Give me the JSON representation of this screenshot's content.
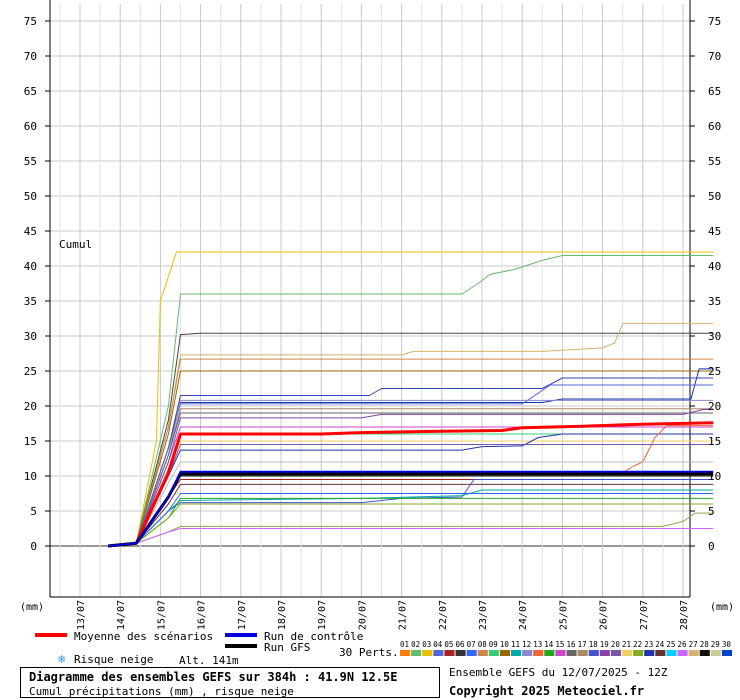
{
  "chart_data": {
    "type": "line",
    "title": "Diagramme des ensembles GEFS sur 384h : 41.9N 12.5E",
    "subtitle": "Cumul précipitations (mm) , risque neige",
    "ylabel": "(mm)",
    "ylabel_right": "(mm)",
    "chart_label": "Cumul",
    "ylim": [
      -10,
      78
    ],
    "yticks": [
      0,
      5,
      10,
      15,
      20,
      25,
      30,
      35,
      40,
      45,
      50,
      55,
      60,
      65,
      70,
      75
    ],
    "x_dates": [
      "13/07",
      "14/07",
      "15/07",
      "16/07",
      "17/07",
      "18/07",
      "19/07",
      "20/07",
      "21/07",
      "22/07",
      "23/07",
      "24/07",
      "25/07",
      "26/07",
      "27/07",
      "28/07"
    ],
    "grid": true,
    "legend": {
      "mean": "Moyenne des scénarios",
      "control": "Run de contrôle",
      "gfs": "Run GFS",
      "perts": "30 Perts.",
      "snow": "Risque neige",
      "altitude": "Alt. 141m"
    },
    "perturbation_labels": [
      "01",
      "02",
      "03",
      "04",
      "05",
      "06",
      "07",
      "08",
      "09",
      "10",
      "11",
      "12",
      "13",
      "14",
      "15",
      "16",
      "17",
      "18",
      "19",
      "20",
      "21",
      "22",
      "23",
      "24",
      "25",
      "26",
      "27",
      "28",
      "29",
      "30"
    ],
    "series": [
      {
        "name": "Moyenne des scénarios",
        "color": "#ff0000",
        "width": 3,
        "points": [
          [
            0.7,
            0
          ],
          [
            1.4,
            0.4
          ],
          [
            2.2,
            10.5
          ],
          [
            2.5,
            16
          ],
          [
            6.0,
            16
          ],
          [
            7.0,
            16.2
          ],
          [
            8.0,
            16.3
          ],
          [
            9.0,
            16.4
          ],
          [
            10.5,
            16.5
          ],
          [
            11.0,
            16.9
          ],
          [
            12.5,
            17.1
          ],
          [
            14.0,
            17.4
          ],
          [
            15.75,
            17.6
          ]
        ]
      },
      {
        "name": "Run de contrôle",
        "color": "#0000dd",
        "width": 2,
        "points": [
          [
            0.7,
            0
          ],
          [
            1.4,
            0.4
          ],
          [
            2.2,
            7
          ],
          [
            2.5,
            10.6
          ],
          [
            15.75,
            10.6
          ]
        ]
      },
      {
        "name": "Run GFS",
        "color": "#000000",
        "width": 3,
        "points": [
          [
            0.7,
            0
          ],
          [
            1.4,
            0.4
          ],
          [
            2.2,
            7
          ],
          [
            2.5,
            10.3
          ],
          [
            15.75,
            10.3
          ]
        ]
      },
      {
        "name": "01",
        "color": "#e8c000",
        "width": 1,
        "points": [
          [
            0.7,
            0
          ],
          [
            1.4,
            0.4
          ],
          [
            1.9,
            15
          ],
          [
            2.0,
            35
          ],
          [
            2.4,
            42
          ],
          [
            15.75,
            42
          ]
        ]
      },
      {
        "name": "02",
        "color": "#66bb66",
        "width": 1,
        "points": [
          [
            0.7,
            0
          ],
          [
            1.4,
            0.4
          ],
          [
            2.2,
            20
          ],
          [
            2.5,
            36
          ],
          [
            9.5,
            36
          ],
          [
            9.9,
            37.5
          ],
          [
            10.2,
            38.8
          ],
          [
            10.8,
            39.5
          ],
          [
            11.5,
            40.8
          ],
          [
            12.0,
            41.5
          ],
          [
            15.75,
            41.5
          ]
        ]
      },
      {
        "name": "03",
        "color": "#444444",
        "width": 1,
        "points": [
          [
            0.7,
            0
          ],
          [
            1.4,
            0.4
          ],
          [
            2.2,
            18
          ],
          [
            2.5,
            30.2
          ],
          [
            3.0,
            30.4
          ],
          [
            15.75,
            30.4
          ]
        ]
      },
      {
        "name": "04",
        "color": "#d8b070",
        "width": 1,
        "points": [
          [
            0.7,
            0
          ],
          [
            1.4,
            0.4
          ],
          [
            2.2,
            17
          ],
          [
            2.5,
            27.3
          ],
          [
            8.0,
            27.3
          ],
          [
            8.3,
            27.8
          ],
          [
            11.5,
            27.8
          ],
          [
            13.0,
            28.3
          ],
          [
            13.3,
            29
          ],
          [
            13.5,
            31.8
          ],
          [
            15.75,
            31.8
          ]
        ]
      },
      {
        "name": "05",
        "color": "#cc8844",
        "width": 1,
        "points": [
          [
            0.7,
            0
          ],
          [
            1.4,
            0.4
          ],
          [
            2.2,
            17
          ],
          [
            2.5,
            26.7
          ],
          [
            15.75,
            26.7
          ]
        ]
      },
      {
        "name": "06",
        "color": "#996600",
        "width": 1,
        "points": [
          [
            0.7,
            0
          ],
          [
            1.4,
            0.4
          ],
          [
            2.2,
            16
          ],
          [
            2.5,
            25
          ],
          [
            15.75,
            25
          ]
        ]
      },
      {
        "name": "07",
        "color": "#1133aa",
        "width": 1,
        "points": [
          [
            0.7,
            0
          ],
          [
            1.4,
            0.4
          ],
          [
            2.2,
            14
          ],
          [
            2.5,
            20.5
          ],
          [
            11.5,
            20.5
          ],
          [
            12.0,
            21
          ],
          [
            15.2,
            21
          ],
          [
            15.4,
            25.3
          ],
          [
            15.75,
            25.3
          ]
        ]
      },
      {
        "name": "08",
        "color": "#3344bb",
        "width": 1,
        "points": [
          [
            0.7,
            0
          ],
          [
            1.4,
            0.4
          ],
          [
            2.2,
            14
          ],
          [
            2.5,
            21.5
          ],
          [
            7.2,
            21.5
          ],
          [
            7.5,
            22.5
          ],
          [
            11.5,
            22.5
          ],
          [
            12.0,
            24
          ],
          [
            15.75,
            24
          ]
        ]
      },
      {
        "name": "09",
        "color": "#5566dd",
        "width": 1,
        "points": [
          [
            0.7,
            0
          ],
          [
            1.4,
            0.4
          ],
          [
            2.2,
            14
          ],
          [
            2.5,
            20.3
          ],
          [
            11.0,
            20.3
          ],
          [
            11.7,
            23
          ],
          [
            15.75,
            23
          ]
        ]
      },
      {
        "name": "10",
        "color": "#8888cc",
        "width": 1,
        "points": [
          [
            0.7,
            0
          ],
          [
            1.4,
            0.4
          ],
          [
            2.2,
            13
          ],
          [
            2.5,
            20.8
          ],
          [
            15.75,
            20.8
          ]
        ]
      },
      {
        "name": "11",
        "color": "#aa8866",
        "width": 1,
        "points": [
          [
            0.7,
            0
          ],
          [
            1.4,
            0.4
          ],
          [
            2.2,
            13
          ],
          [
            2.5,
            19.6
          ],
          [
            15.75,
            19.6
          ]
        ]
      },
      {
        "name": "12",
        "color": "#666666",
        "width": 1,
        "points": [
          [
            0.7,
            0
          ],
          [
            1.4,
            0.4
          ],
          [
            2.2,
            13
          ],
          [
            2.5,
            19
          ],
          [
            15.75,
            19
          ]
        ]
      },
      {
        "name": "13",
        "color": "#cc44cc",
        "width": 1,
        "points": [
          [
            0.7,
            0
          ],
          [
            1.4,
            0.4
          ],
          [
            2.2,
            12
          ],
          [
            2.5,
            17
          ],
          [
            15.75,
            17
          ]
        ]
      },
      {
        "name": "14",
        "color": "#33cc77",
        "width": 1,
        "points": [
          [
            0.7,
            0
          ],
          [
            1.4,
            0.4
          ],
          [
            2.2,
            11
          ],
          [
            2.5,
            16
          ],
          [
            15.75,
            16
          ]
        ]
      },
      {
        "name": "15",
        "color": "#f0d060",
        "width": 1,
        "points": [
          [
            0.7,
            0
          ],
          [
            1.4,
            0.4
          ],
          [
            2.2,
            11
          ],
          [
            2.5,
            15
          ],
          [
            15.75,
            15
          ]
        ]
      },
      {
        "name": "16",
        "color": "#2233aa",
        "width": 1,
        "points": [
          [
            0.7,
            0
          ],
          [
            1.4,
            0.4
          ],
          [
            2.2,
            10
          ],
          [
            2.5,
            13.7
          ],
          [
            9.5,
            13.7
          ],
          [
            10.0,
            14.2
          ],
          [
            11.0,
            14.3
          ],
          [
            11.4,
            15.5
          ],
          [
            12.0,
            16
          ],
          [
            15.75,
            16
          ]
        ]
      },
      {
        "name": "17",
        "color": "#ee6633",
        "width": 1,
        "points": [
          [
            0.7,
            0
          ],
          [
            1.4,
            0.4
          ],
          [
            2.2,
            7
          ],
          [
            2.5,
            10.5
          ],
          [
            13.5,
            10.5
          ],
          [
            13.8,
            11.5
          ],
          [
            14.0,
            12
          ],
          [
            14.3,
            15.5
          ],
          [
            14.6,
            17.2
          ],
          [
            15.75,
            17.2
          ]
        ]
      },
      {
        "name": "18",
        "color": "#111111",
        "width": 1,
        "points": [
          [
            0.7,
            0
          ],
          [
            1.4,
            0.4
          ],
          [
            2.2,
            7
          ],
          [
            2.5,
            10
          ],
          [
            15.75,
            10
          ]
        ]
      },
      {
        "name": "19",
        "color": "#aa2222",
        "width": 1,
        "points": [
          [
            0.7,
            0
          ],
          [
            1.4,
            0.4
          ],
          [
            2.2,
            7
          ],
          [
            2.5,
            9.5
          ],
          [
            15.75,
            9.5
          ]
        ]
      },
      {
        "name": "20",
        "color": "#663333",
        "width": 1,
        "points": [
          [
            0.7,
            0
          ],
          [
            1.4,
            0.4
          ],
          [
            2.2,
            6
          ],
          [
            2.5,
            8.8
          ],
          [
            15.75,
            8.8
          ]
        ]
      },
      {
        "name": "21",
        "color": "#4455cc",
        "width": 1,
        "points": [
          [
            0.7,
            0
          ],
          [
            1.4,
            0.4
          ],
          [
            2.2,
            5
          ],
          [
            2.5,
            6.2
          ],
          [
            7.0,
            6.2
          ],
          [
            8.0,
            6.8
          ],
          [
            9.5,
            7
          ],
          [
            9.8,
            9.5
          ],
          [
            15.75,
            9.5
          ]
        ]
      },
      {
        "name": "22",
        "color": "#00aaaa",
        "width": 1,
        "points": [
          [
            0.7,
            0
          ],
          [
            1.4,
            0.4
          ],
          [
            2.2,
            5
          ],
          [
            2.5,
            6.5
          ],
          [
            7.0,
            6.8
          ],
          [
            9.5,
            7.2
          ],
          [
            10.0,
            8
          ],
          [
            15.75,
            8
          ]
        ]
      },
      {
        "name": "23",
        "color": "#3366ff",
        "width": 1,
        "points": [
          [
            0.7,
            0
          ],
          [
            1.4,
            0.4
          ],
          [
            2.2,
            5
          ],
          [
            2.5,
            7.5
          ],
          [
            15.75,
            7.5
          ]
        ]
      },
      {
        "name": "24",
        "color": "#22aa22",
        "width": 1,
        "points": [
          [
            0.7,
            0
          ],
          [
            1.4,
            0.4
          ],
          [
            2.2,
            4
          ],
          [
            2.5,
            6.8
          ],
          [
            15.75,
            6.8
          ]
        ]
      },
      {
        "name": "25",
        "color": "#88aa22",
        "width": 1,
        "points": [
          [
            0.7,
            0
          ],
          [
            1.4,
            0.4
          ],
          [
            2.2,
            4
          ],
          [
            2.5,
            6
          ],
          [
            15.75,
            6
          ]
        ]
      },
      {
        "name": "26",
        "color": "#88aa44",
        "width": 1,
        "points": [
          [
            0.7,
            0
          ],
          [
            1.4,
            0.4
          ],
          [
            2.2,
            2
          ],
          [
            2.5,
            2.8
          ],
          [
            14.5,
            2.8
          ],
          [
            15.0,
            3.5
          ],
          [
            15.3,
            4.7
          ],
          [
            15.75,
            4.7
          ]
        ]
      },
      {
        "name": "27",
        "color": "#cc66ff",
        "width": 1,
        "points": [
          [
            0.7,
            0
          ],
          [
            1.4,
            0.4
          ],
          [
            2.2,
            2
          ],
          [
            2.5,
            2.5
          ],
          [
            15.75,
            2.5
          ]
        ]
      },
      {
        "name": "28",
        "color": "#8844aa",
        "width": 1,
        "points": [
          [
            0.7,
            0
          ],
          [
            1.4,
            0.4
          ],
          [
            2.2,
            12
          ],
          [
            2.5,
            18.3
          ],
          [
            7.0,
            18.3
          ],
          [
            7.5,
            18.8
          ],
          [
            15.0,
            18.8
          ],
          [
            15.5,
            19.5
          ],
          [
            15.75,
            19.5
          ]
        ]
      },
      {
        "name": "29",
        "color": "#7755aa",
        "width": 1,
        "points": [
          [
            0.7,
            0
          ],
          [
            1.4,
            0.4
          ],
          [
            2.2,
            10
          ],
          [
            2.5,
            14.5
          ],
          [
            15.75,
            14.5
          ]
        ]
      },
      {
        "name": "30",
        "color": "#bbbbbb",
        "width": 1,
        "points": [
          [
            0.7,
            0
          ],
          [
            1.4,
            0.4
          ],
          [
            2.2,
            9
          ],
          [
            2.5,
            12
          ],
          [
            15.75,
            12
          ]
        ]
      }
    ]
  },
  "legend_colors": {
    "mean": "#ff0000",
    "control": "#0000dd",
    "gfs": "#000000",
    "snow": "#3399ff"
  },
  "pert_swatch_colors": [
    "#ff7f00",
    "#66bb66",
    "#e8c000",
    "#5566dd",
    "#aa2222",
    "#333333",
    "#3366ff",
    "#cc8844",
    "#33cc77",
    "#996600",
    "#00aaaa",
    "#8888cc",
    "#ee6633",
    "#22aa22",
    "#cc44cc",
    "#666666",
    "#aa8866",
    "#4455cc",
    "#8844aa",
    "#7755aa",
    "#f0d060",
    "#88aa22",
    "#2233aa",
    "#663333",
    "#00ccff",
    "#cc66ff",
    "#d8b070",
    "#111111",
    "#cccc99",
    "#0044cc"
  ],
  "footer": {
    "title": "Diagramme des ensembles GEFS sur 384h : 41.9N 12.5E",
    "subtitle": "Cumul précipitations (mm) , risque neige",
    "run_info": "Ensemble GEFS du 12/07/2025 - 12Z",
    "copyright": "Copyright 2025 Meteociel.fr"
  }
}
